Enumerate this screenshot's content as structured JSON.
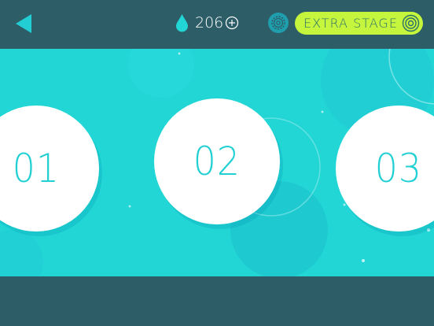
{
  "topbar": {
    "back_icon": "back-triangle-icon",
    "drops": {
      "icon": "water-drop-icon",
      "count": "206"
    },
    "add_icon": "plus-circle-icon",
    "settings_icon": "gear-icon",
    "extra_stage": {
      "label": "EXTRA STAGE",
      "icon": "concentric-circles-icon"
    }
  },
  "stages": [
    {
      "number": "01"
    },
    {
      "number": "02"
    },
    {
      "number": "03"
    }
  ],
  "colors": {
    "bar": "#2d5e68",
    "stage_bg": "#22d6d6",
    "accent": "#c5f53c",
    "stage_number": "#22d0d4",
    "stage_circle": "#ffffff"
  }
}
